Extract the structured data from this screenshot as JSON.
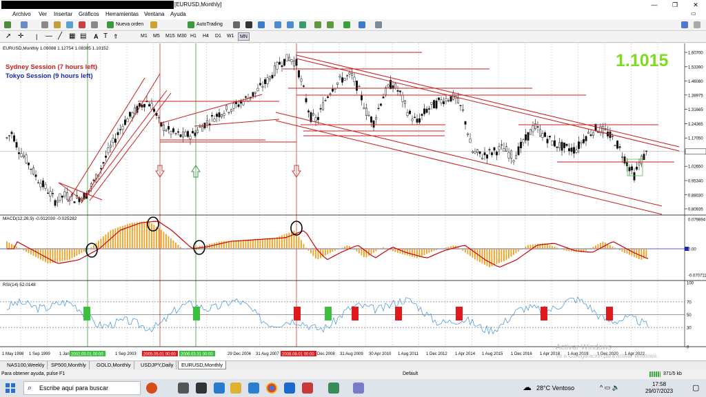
{
  "window": {
    "title": "[EURUSD,Monthly]",
    "min": "—",
    "max": "❐",
    "close": "✕"
  },
  "menu": [
    "Archivo",
    "Ver",
    "Insertar",
    "Gráficos",
    "Herramientas",
    "Ventana",
    "Ayuda"
  ],
  "toolbar": {
    "new_order": "Nueva orden",
    "autotrading": "AutoTrading",
    "timeframes": [
      "M1",
      "M5",
      "M15",
      "M30",
      "H1",
      "H4",
      "D1",
      "W1",
      "MN"
    ]
  },
  "chart": {
    "header": "EURUSD,Monthly  1.09088 1.12754 1.08305 1.10152",
    "big_price": "1.1015",
    "sydney": "Sydney Session (7 hours left)",
    "tokyo": "Tokyo Session (9 hours left)",
    "price_levels": [
      "1.60700",
      "1.53390",
      "1.46080",
      "1.38975",
      "1.31665",
      "1.24365",
      "1.17050",
      "1.10152",
      "1.02650",
      "0.95340",
      "0.88030",
      "0.80935"
    ],
    "current_price": "1.10152",
    "macd_label": "MACD(12,26,9) -0.012030 -0.025282",
    "macd_levels": [
      "0.079894",
      "0.00",
      "-0.070711"
    ],
    "rsi_label": "RSI(14) 52.0148",
    "rsi_levels": [
      "100",
      "70",
      "50",
      "30",
      "0"
    ],
    "dates": [
      "1 May 1998",
      "1 Sep 1999",
      "1 Jan",
      "1 Sep 2003",
      "1 Dec 2006",
      "29 Dec 2006",
      "31 Aug 2007",
      "1 Dec 2008",
      "31 Aug 2009",
      "30 Apr 2010",
      "1 Aug 2011",
      "1 Dec 2012",
      "1 Apr 2014",
      "1 Aug 2015",
      "1 Dec 2016",
      "1 Apr 2018",
      "1 Aug 2019",
      "1 Dec 2020",
      "1 Apr 2022"
    ],
    "marked_dates": [
      "2002.05.01 00:00",
      "2005.05.01 00:00",
      "2006.03.31 00:00",
      "2008.08.01 00:00"
    ],
    "watermark_title": "Activar Windows",
    "watermark_sub": "Ve a Configuración para activar Windows."
  },
  "tabs": [
    "NAS100,Weekly",
    "SP500,Monthly",
    "GOLD,Monthly",
    "USDJPY,Daily",
    "EURUSD,Monthly"
  ],
  "active_tab": 4,
  "status": {
    "help": "Para obtener ayuda, pulse F1",
    "profile": "Default",
    "traffic": "371/5 kb"
  },
  "taskbar": {
    "search_placeholder": "Escribe aquí para buscar",
    "weather": "28°C  Ventoso",
    "time": "17:58",
    "date": "29/07/2023"
  },
  "colors": {
    "candle": "#111111",
    "trendline": "#cc1a1a",
    "macd_hist": "#f0a020",
    "macd_signal": "#cc0000",
    "rsi_line": "#3a8fd8",
    "buy": "#3cbf3c",
    "sell": "#e0191d",
    "big_price": "#7ddc1f"
  }
}
